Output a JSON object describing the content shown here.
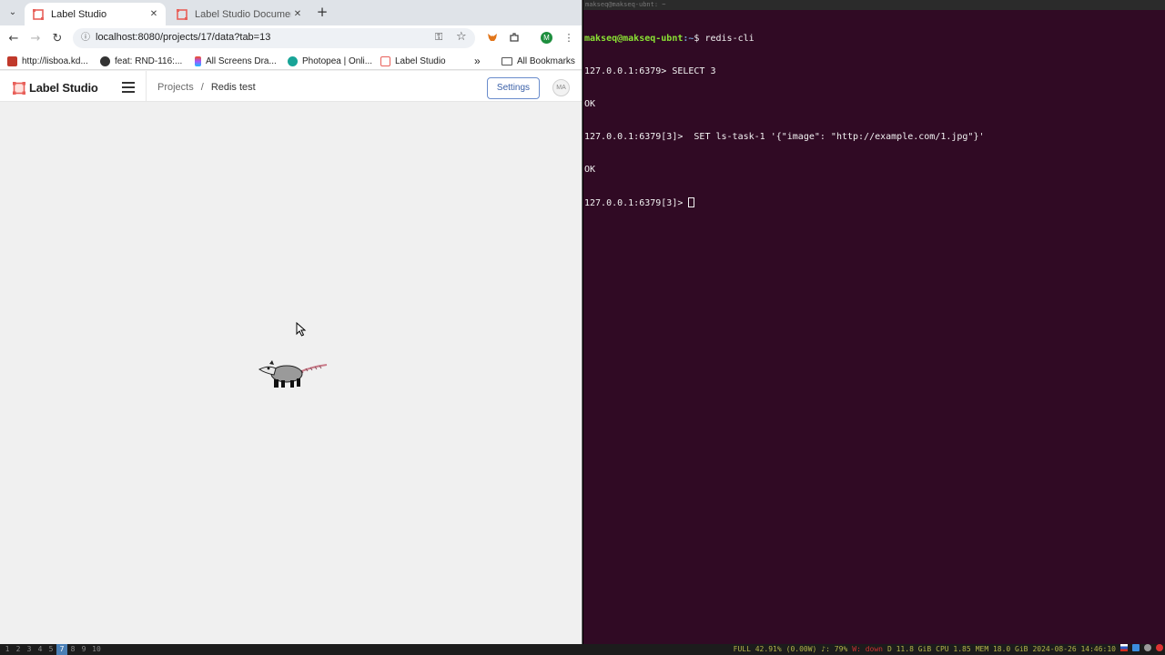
{
  "browser": {
    "tabs": [
      {
        "title": "Label Studio",
        "active": true
      },
      {
        "title": "Label Studio Documentat",
        "active": false
      }
    ],
    "url": "localhost:8080/projects/17/data?tab=13",
    "profile_initial": "M",
    "bookmarks": [
      {
        "label": "http://lisboa.kd...",
        "icon_color": "#c0392b"
      },
      {
        "label": "feat: RND-116:...",
        "icon_color": "#333333"
      },
      {
        "label": "All Screens Dra...",
        "icon_color": "#a259ff"
      },
      {
        "label": "Photopea | Onli...",
        "icon_color": "#18a497"
      },
      {
        "label": "Label Studio",
        "icon_color": "#e8605a"
      }
    ],
    "all_bookmarks_label": "All Bookmarks",
    "overflow_label": "»"
  },
  "app": {
    "logo_text": "Label Studio",
    "breadcrumb": {
      "parent": "Projects",
      "separator": "/",
      "current": "Redis test"
    },
    "settings_label": "Settings",
    "user_initials": "MA",
    "accent_color": "#3a60a8"
  },
  "terminal": {
    "title": "makseq@makseq-ubnt: ~",
    "lines": [
      {
        "user": "makseq@makseq-ubnt",
        "path": ":~",
        "symbol": "$ ",
        "cmd": "redis-cli"
      },
      {
        "text": "127.0.0.1:6379> SELECT 3"
      },
      {
        "text": "OK"
      },
      {
        "text": "127.0.0.1:6379[3]>  SET ls-task-1 '{\"image\": \"http://example.com/1.jpg\"}'"
      },
      {
        "text": "OK"
      },
      {
        "text": "127.0.0.1:6379[3]> "
      }
    ]
  },
  "statusbar": {
    "workspaces": [
      "1",
      "2",
      "3",
      "4",
      "5",
      "7",
      "8",
      "9",
      "10"
    ],
    "active_workspace": "7",
    "battery": "FULL 42.91%",
    "power": "(0.00W)",
    "volume": "♪: 79%",
    "wifi": "W: down",
    "disk": "D 11.8 GiB",
    "cpu": "CPU 1.85",
    "mem": "MEM 18.0 GiB",
    "datetime": "2024-08-26 14:46:10"
  }
}
